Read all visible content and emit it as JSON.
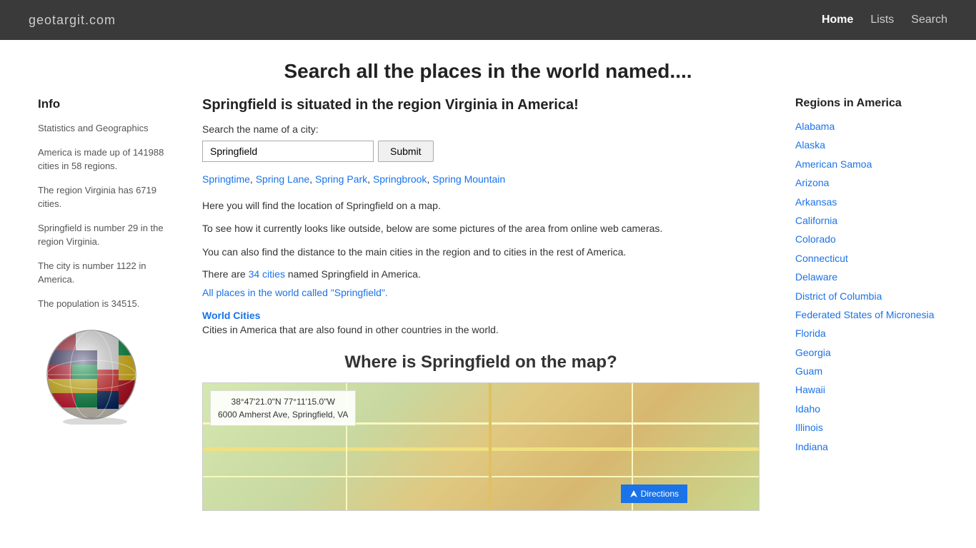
{
  "header": {
    "logo": "geotargit.com",
    "nav": [
      {
        "label": "Home",
        "active": true
      },
      {
        "label": "Lists",
        "active": false
      },
      {
        "label": "Search",
        "active": false
      }
    ]
  },
  "page_title": "Search all the places in the world named....",
  "main": {
    "heading": "Springfield is situated in the region Virginia in America!",
    "search_label": "Search the name of a city:",
    "search_value": "Springfield",
    "submit_label": "Submit",
    "suggestions": [
      "Springtime",
      "Spring Lane",
      "Spring Park",
      "Springbrook",
      "Spring Mountain"
    ],
    "description_lines": [
      "Here you will find the location of Springfield on a map.",
      "To see how it currently looks like outside, below are some pictures of the area from online web cameras.",
      "You can also find the distance to the main cities in the region and to cities in the rest of America."
    ],
    "cities_count_text_before": "There are ",
    "cities_count": "34 cities",
    "cities_count_text_after": " named Springfield in America.",
    "world_places_link": "All places in the world called \"Springfield\".",
    "world_cities_heading": "World Cities",
    "world_cities_desc": "Cities in America that are also found in other countries in the world.",
    "map_title": "Where is Springfield on the map?",
    "map_coords": "38°47'21.0\"N 77°11'15.0\"W",
    "map_address": "6000 Amherst Ave, Springfield, VA",
    "map_directions_label": "Directions"
  },
  "sidebar_left": {
    "heading": "Info",
    "stats_heading": "Statistics and Geographics",
    "america_stat": "America is made up of 141988 cities in 58 regions.",
    "virginia_stat": "The region Virginia has 6719 cities.",
    "springfield_rank": "Springfield is number 29 in the region Virginia.",
    "city_number": "The city is number 1122 in America.",
    "population": "The population is 34515."
  },
  "sidebar_right": {
    "heading": "Regions in America",
    "regions": [
      "Alabama",
      "Alaska",
      "American Samoa",
      "Arizona",
      "Arkansas",
      "California",
      "Colorado",
      "Connecticut",
      "Delaware",
      "District of Columbia",
      "Federated States of Micronesia",
      "Florida",
      "Georgia",
      "Guam",
      "Hawaii",
      "Idaho",
      "Illinois",
      "Indiana"
    ]
  }
}
